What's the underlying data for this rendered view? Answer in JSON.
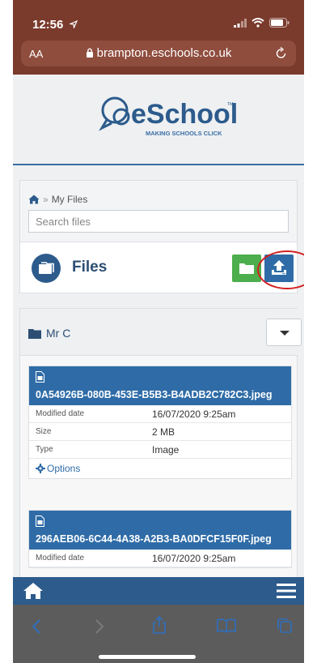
{
  "status_bar": {
    "time": "12:56"
  },
  "browser": {
    "text_size_label": "AA",
    "url": "brampton.eschools.co.uk"
  },
  "logo": {
    "name": "eSchools",
    "tagline": "MAKING SCHOOLS CLICK",
    "tm": "TM"
  },
  "breadcrumb": {
    "separator": "»",
    "current": "My Files"
  },
  "search": {
    "placeholder": "Search files",
    "value": ""
  },
  "files_header": {
    "title": "Files"
  },
  "folder": {
    "name": "Mr C"
  },
  "files": [
    {
      "name": "0A54926B-080B-453E-B5B3-B4ADB2C782C3.jpeg",
      "modified_label": "Modified date",
      "modified": "16/07/2020 9:25am",
      "size_label": "Size",
      "size": "2 MB",
      "type_label": "Type",
      "type": "Image",
      "options_label": "Options"
    },
    {
      "name": "296AEB06-6C44-4A38-A2B3-BA0DFCF15F0F.jpeg",
      "modified_label": "Modified date",
      "modified": "16/07/2020 9:25am"
    }
  ],
  "colors": {
    "browser_chrome": "#7a3a2c",
    "brand_blue": "#2f6ca7",
    "brand_dark": "#2c4e73",
    "folder_green": "#4cae4c",
    "highlight_red": "#d42020"
  }
}
